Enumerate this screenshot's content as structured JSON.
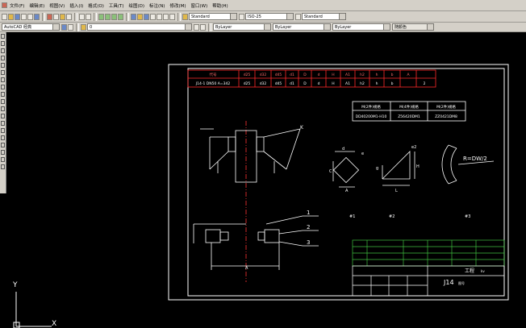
{
  "menu": [
    "文件(F)",
    "编辑(E)",
    "视图(V)",
    "插入(I)",
    "格式(O)",
    "工具(T)",
    "绘图(D)",
    "标注(N)",
    "修改(M)",
    "窗口(W)",
    "帮助(H)"
  ],
  "toolbar1": {
    "text_style": "Standard",
    "dim_style": "ISO-25",
    "table_style": "Standard"
  },
  "toolbar2": {
    "workspace": "AutoCAD 经典",
    "layer": "0",
    "color": "ByLayer",
    "linetype": "ByLayer",
    "lineweight": "ByLayer",
    "plotstyle": "随颜色"
  },
  "colors": {
    "frame": "#ffffff",
    "table_red": "#ff2a2a",
    "center_red": "#ff3333",
    "titleblock_green": "#3fbf3f",
    "text_white": "#ffffff"
  },
  "drawing": {
    "spec_header": [
      "代号",
      "d25",
      "d32",
      "d45",
      "d1",
      "D",
      "d",
      "H",
      "A1",
      "h2",
      "h",
      "b",
      "A"
    ],
    "spec_row": [
      "J14-1 DN50 A=342",
      "d25",
      "d32",
      "d45",
      "d1",
      "D",
      "d",
      "H",
      "A1",
      "h2",
      "h",
      "b",
      "2"
    ],
    "side_table": {
      "headers": [
        "M(2件)规格",
        "M(4件)规格",
        "M(2件)规格"
      ],
      "values": [
        "DD40200M1-H10",
        "Z56420DM1",
        "ZZ0421DM8"
      ]
    },
    "labels": {
      "k_left": "K",
      "callout_1": "1",
      "callout_2": "2",
      "callout_3": "3",
      "dim_a": "A",
      "dim_l": "L",
      "dim_h": "H",
      "dim_e2": "e2",
      "dim_c": "C",
      "dim_a2": "A",
      "dim_g": "g",
      "dim_e": "e",
      "dim_d": "d",
      "radius": "R=DW/2",
      "note_1": "#1",
      "note_2": "#2",
      "note_3": "#3",
      "tb_project": "工程",
      "tb_sheet": "J14",
      "tb_unit": "kv",
      "tb_no": "图号"
    }
  },
  "ucs": {
    "y": "Y",
    "x": "X"
  }
}
